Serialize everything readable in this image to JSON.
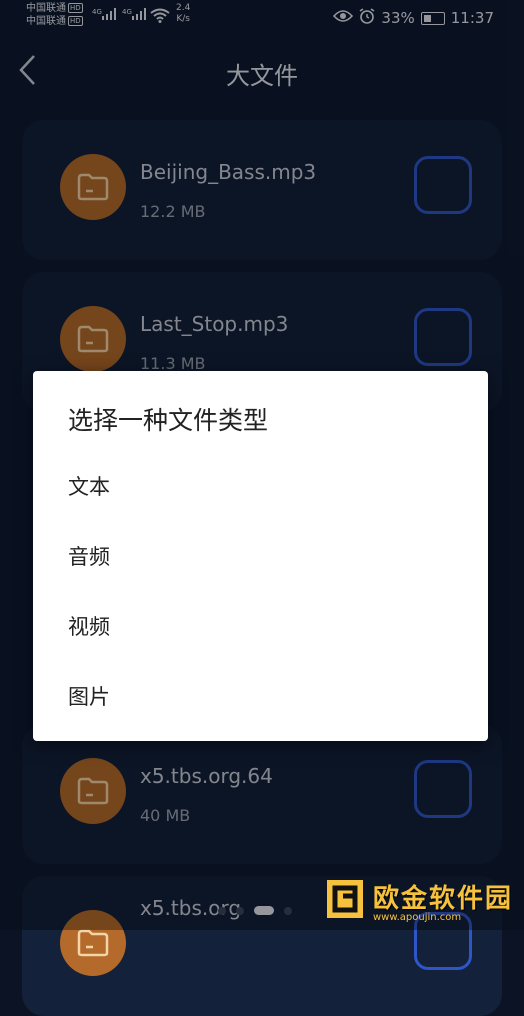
{
  "status_bar": {
    "carrier1": "中国联通",
    "carrier2": "中国联通",
    "hd": "HD",
    "net1": "4G",
    "net2": "4G",
    "speed_value": "2.4",
    "speed_unit": "K/s",
    "battery": "33%",
    "time": "11:37"
  },
  "header": {
    "title": "大文件"
  },
  "files": [
    {
      "name": "Beijing_Bass.mp3",
      "size": "12.2 MB",
      "checked": false
    },
    {
      "name": "Last_Stop.mp3",
      "size": "11.3 MB",
      "checked": false
    },
    {
      "name": "x5.tbs.org.64",
      "size": "40 MB",
      "checked": false
    },
    {
      "name": "x5.tbs.org",
      "size": "",
      "checked": false
    }
  ],
  "dialog": {
    "title": "选择一种文件类型",
    "options": [
      "文本",
      "音频",
      "视频",
      "图片"
    ]
  },
  "pager": {
    "count": 4,
    "active_index": 2
  },
  "watermark": {
    "text": "欧金软件园",
    "url": "www.apoujin.com"
  },
  "colors": {
    "background": "#0f1b33",
    "folder": "#b46a2a",
    "checkbox_border": "#2f56c9",
    "dialog_bg": "#ffffff"
  }
}
